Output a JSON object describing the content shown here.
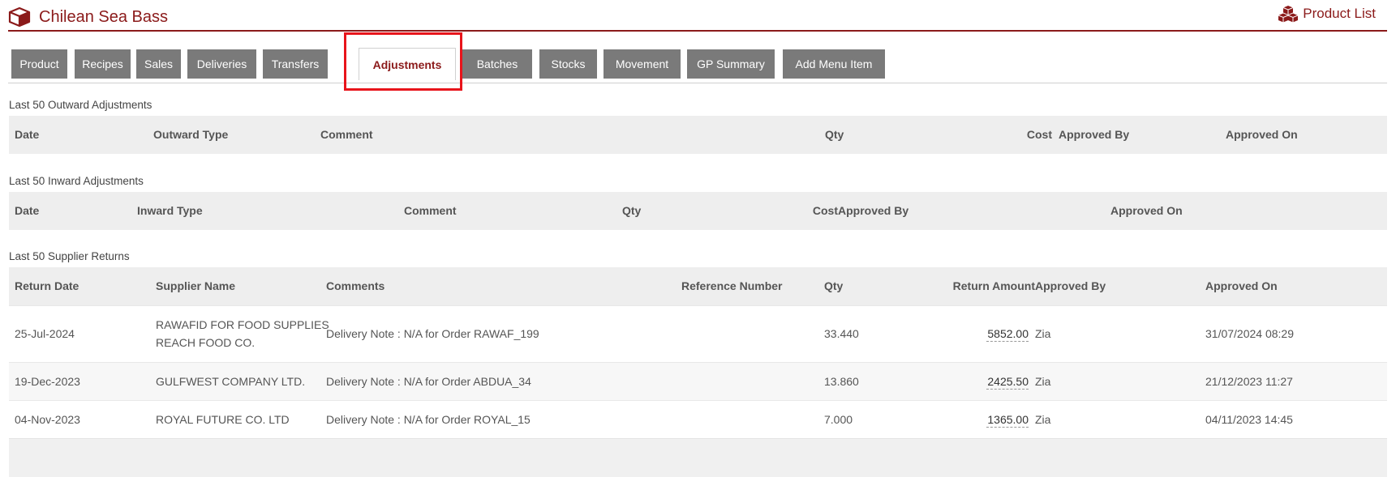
{
  "header": {
    "title": "Chilean Sea Bass",
    "product_list_label": "Product List",
    "accent_color": "#8b1a1a"
  },
  "tabs": [
    {
      "label": "Product"
    },
    {
      "label": "Recipes"
    },
    {
      "label": "Sales"
    },
    {
      "label": "Deliveries"
    },
    {
      "label": "Transfers"
    },
    {
      "label": "Adjustments",
      "active": true
    },
    {
      "label": "Batches"
    },
    {
      "label": "Stocks"
    },
    {
      "label": "Movement"
    },
    {
      "label": "GP Summary"
    },
    {
      "label": "Add Menu Item"
    }
  ],
  "outward": {
    "title": "Last 50 Outward Adjustments",
    "columns": [
      "Date",
      "Outward Type",
      "Comment",
      "Qty",
      "Cost",
      "Approved By",
      "Approved On"
    ]
  },
  "inward": {
    "title": "Last 50 Inward Adjustments",
    "columns": [
      "Date",
      "Inward Type",
      "Comment",
      "Qty",
      "Cost",
      "Approved By",
      "Approved On"
    ]
  },
  "returns": {
    "title": "Last 50 Supplier Returns",
    "columns": [
      "Return Date",
      "Supplier Name",
      "Comments",
      "Reference Number",
      "Qty",
      "Return Amount",
      "Approved By",
      "Approved On"
    ],
    "rows": [
      {
        "date": "25-Jul-2024",
        "supplier_line1": "RAWAFID FOR FOOD SUPPLIES",
        "supplier_line2": "REACH FOOD CO.",
        "comments": "Delivery Note : N/A for Order RAWAF_199",
        "reference": "",
        "qty": "33.440",
        "amount": "5852.00",
        "approved_by": "Zia",
        "approved_on": "31/07/2024 08:29"
      },
      {
        "date": "19-Dec-2023",
        "supplier_line1": "GULFWEST COMPANY LTD.",
        "supplier_line2": "",
        "comments": "Delivery Note : N/A for Order ABDUA_34",
        "reference": "",
        "qty": "13.860",
        "amount": "2425.50",
        "approved_by": "Zia",
        "approved_on": "21/12/2023 11:27"
      },
      {
        "date": "04-Nov-2023",
        "supplier_line1": "ROYAL FUTURE CO. LTD",
        "supplier_line2": "",
        "comments": "Delivery Note : N/A for Order ROYAL_15",
        "reference": "",
        "qty": "7.000",
        "amount": "1365.00",
        "approved_by": "Zia",
        "approved_on": "04/11/2023 14:45"
      }
    ]
  }
}
